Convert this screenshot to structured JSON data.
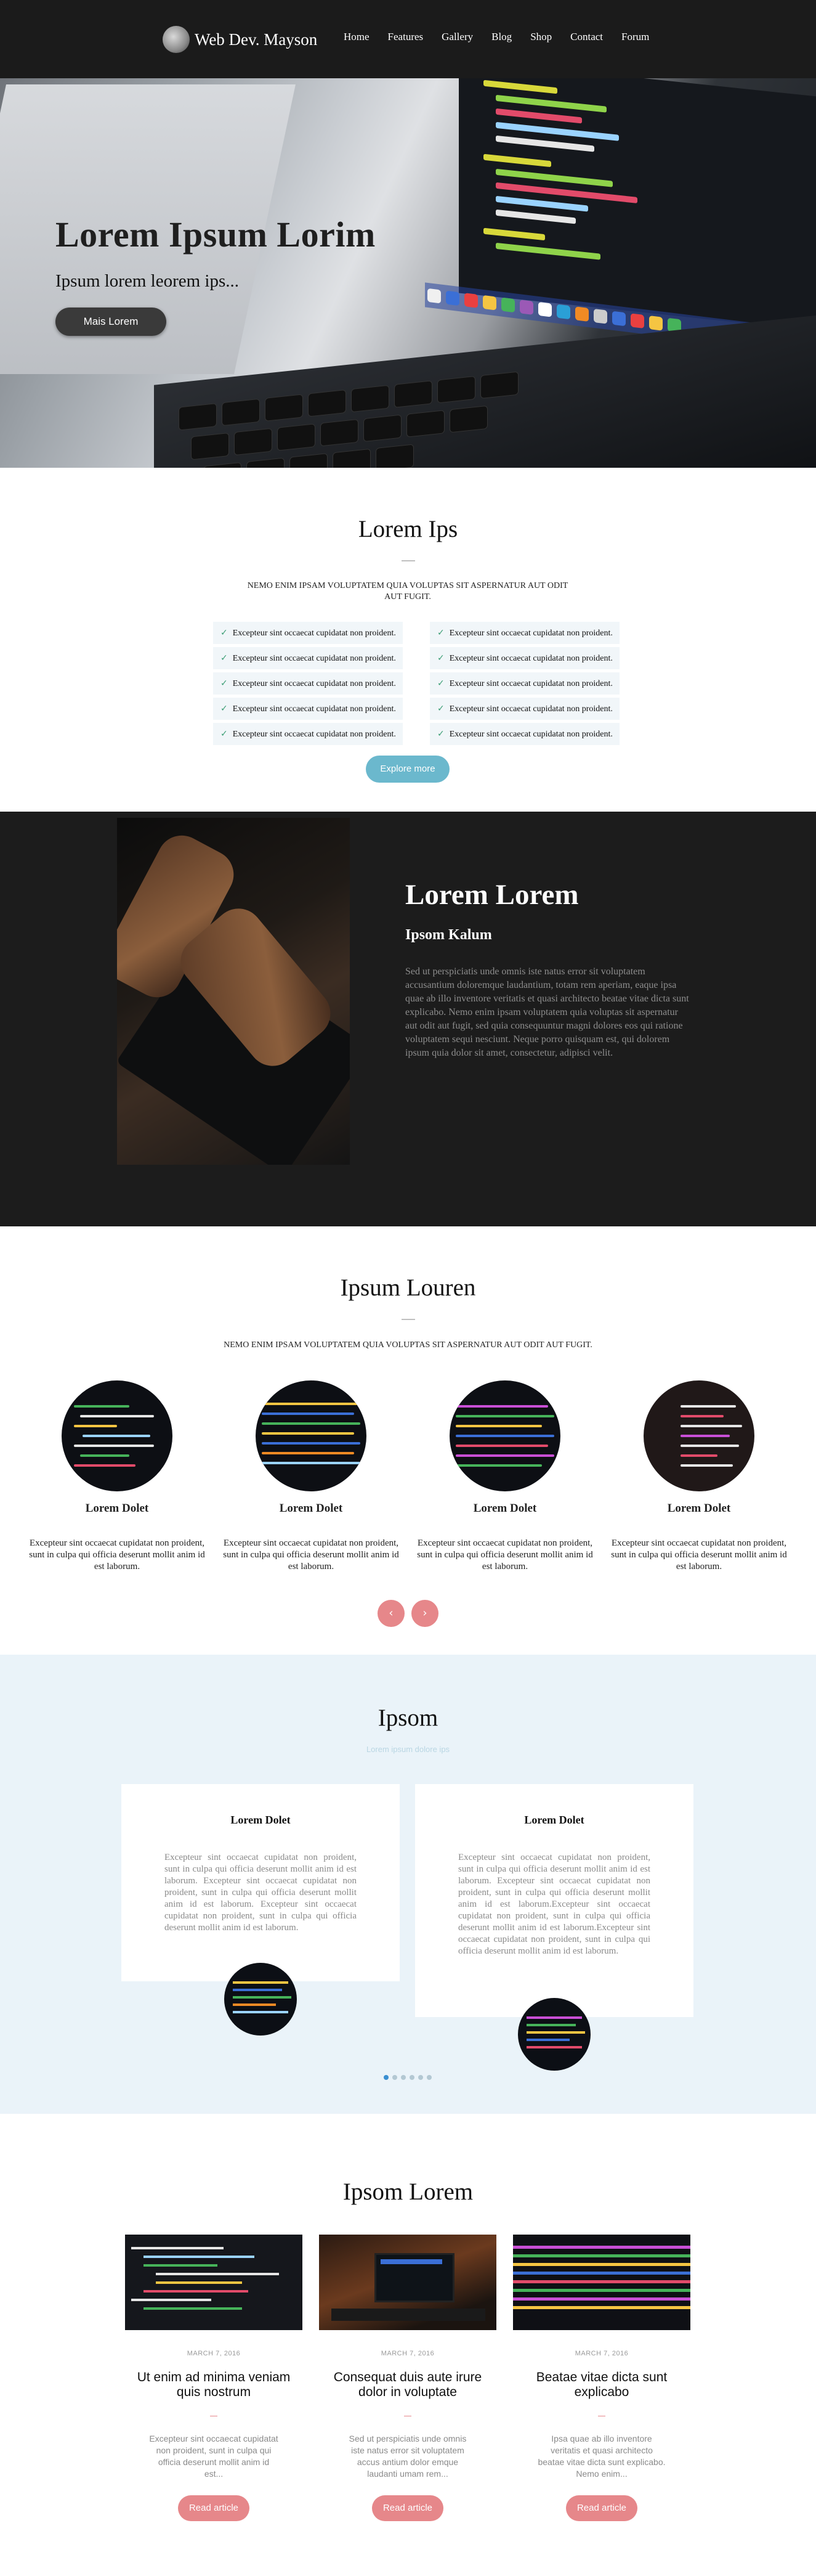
{
  "nav": {
    "brand": "Web Dev. Mayson",
    "items": [
      {
        "label": "Home"
      },
      {
        "label": "Features"
      },
      {
        "label": "Gallery"
      },
      {
        "label": "Blog"
      },
      {
        "label": "Shop"
      },
      {
        "label": "Contact"
      },
      {
        "label": "Forum"
      }
    ]
  },
  "hero": {
    "title": "Lorem Ipsum Lorim",
    "subtitle": "Ipsum lorem leorem ips...",
    "button": "Mais Lorem"
  },
  "features_section": {
    "title": "Lorem Ips",
    "text": "NEMO ENIM IPSAM VOLUPTATEM QUIA VOLUPTAS SIT ASPERNATUR AUT ODIT AUT FUGIT.",
    "items": [
      "Excepteur sint occaecat cupidatat non proident.",
      "Excepteur sint occaecat cupidatat non proident.",
      "Excepteur sint occaecat cupidatat non proident.",
      "Excepteur sint occaecat cupidatat non proident.",
      "Excepteur sint occaecat cupidatat non proident.",
      "Excepteur sint occaecat cupidatat non proident.",
      "Excepteur sint occaecat cupidatat non proident.",
      "Excepteur sint occaecat cupidatat non proident.",
      "Excepteur sint occaecat cupidatat non proident.",
      "Excepteur sint occaecat cupidatat non proident."
    ],
    "button": "Explore more",
    "check_color": "#3a9d74",
    "button_color": "#6bb8cd"
  },
  "about_section": {
    "title": "Lorem Lorem",
    "subtitle": "Ipsom Kalum",
    "text": "Sed ut perspiciatis unde omnis iste natus error sit voluptatem accusantium doloremque laudantium, totam rem aperiam, eaque ipsa quae ab illo inventore veritatis et quasi architecto beatae vitae dicta sunt explicabo. Nemo enim ipsam voluptatem quia voluptas sit aspernatur aut odit aut fugit, sed quia consequuntur magni dolores eos qui ratione voluptatem sequi nesciunt. Neque porro quisquam est, qui dolorem ipsum quia dolor sit amet, consectetur, adipisci velit."
  },
  "team_section": {
    "title": "Ipsum Louren",
    "text": "NEMO ENIM IPSAM VOLUPTATEM QUIA VOLUPTAS SIT ASPERNATUR AUT ODIT AUT FUGIT.",
    "members": [
      {
        "name": "Lorem Dolet",
        "text": "Excepteur sint occaecat cupidatat non proident, sunt in culpa qui officia deserunt mollit anim id est laborum."
      },
      {
        "name": "Lorem Dolet",
        "text": "Excepteur sint occaecat cupidatat non proident, sunt in culpa qui officia deserunt mollit anim id est laborum."
      },
      {
        "name": "Lorem Dolet",
        "text": "Excepteur sint occaecat cupidatat non proident, sunt in culpa qui officia deserunt mollit anim id est laborum."
      },
      {
        "name": "Lorem Dolet",
        "text": "Excepteur sint occaecat cupidatat non proident, sunt in culpa qui officia deserunt mollit anim id est laborum."
      }
    ],
    "prev": "‹",
    "next": "›",
    "accent_color": "#e6878a"
  },
  "testimonials_section": {
    "title": "Ipsom",
    "subtitle": "Lorem ipsum dolore ips",
    "cards": [
      {
        "name": "Lorem Dolet",
        "text": "Excepteur sint occaecat cupidatat non proident, sunt in culpa qui officia deserunt mollit anim id est laborum. Excepteur sint occaecat cupidatat non proident, sunt in culpa qui officia deserunt mollit anim id est laborum. Excepteur sint occaecat cupidatat non proident, sunt in culpa qui officia deserunt mollit anim id est laborum."
      },
      {
        "name": "Lorem Dolet",
        "text": "Excepteur sint occaecat cupidatat non proident, sunt in culpa qui officia deserunt mollit anim id est laborum. Excepteur sint occaecat cupidatat non proident, sunt in culpa qui officia deserunt mollit anim id est laborum.Excepteur sint occaecat cupidatat non proident, sunt in culpa qui officia deserunt mollit anim id est laborum.Excepteur sint occaecat cupidatat non proident, sunt in culpa qui officia deserunt mollit anim id est laborum."
      }
    ],
    "active_slide": 1,
    "slide_count": 6,
    "background": "#eaf3f9"
  },
  "blog_section": {
    "title": "Ipsom Lorem",
    "posts": [
      {
        "date": "MARCH 7, 2016",
        "title": "Ut enim ad minima veniam quis nostrum",
        "text": "Excepteur sint occaecat cupidatat non proident, sunt in culpa qui officia deserunt mollit anim id est...",
        "button": "Read article"
      },
      {
        "date": "MARCH 7, 2016",
        "title": "Consequat duis aute irure dolor in voluptate",
        "text": "Sed ut perspiciatis unde omnis iste natus error sit voluptatem accus antium dolor emque laudanti umam rem...",
        "button": "Read article"
      },
      {
        "date": "MARCH 7, 2016",
        "title": "Beatae vitae dicta sunt explicabo",
        "text": "Ipsa quae ab illo inventore veritatis et quasi architecto beatae vitae dicta sunt explicabo. Nemo enim...",
        "button": "Read article"
      }
    ]
  }
}
